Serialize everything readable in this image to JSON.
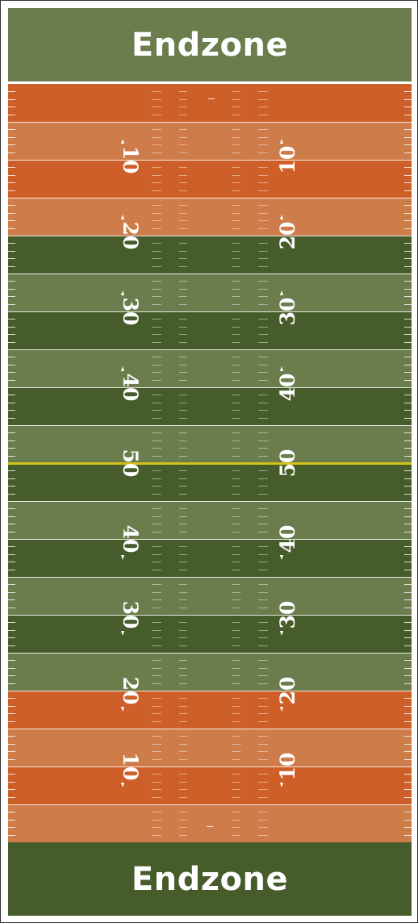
{
  "endzones": {
    "top_label": "Endzone",
    "bottom_label": "Endzone",
    "top_color": "#6b7d4c",
    "bottom_color": "#465c2b"
  },
  "colors": {
    "orange_dark": "#cf5f29",
    "orange_light": "#cd7c4a",
    "green_dark": "#465c2b",
    "green_light": "#6b7d4c",
    "yard_line": "#ffffff",
    "midfield_line": "#d4c21a",
    "hash_mark": "#ffffff",
    "number_color": "#ffffff"
  },
  "field": {
    "band_colors": [
      "orange_dark",
      "orange_light",
      "orange_dark",
      "orange_light",
      "green_dark",
      "green_light",
      "green_dark",
      "green_light",
      "green_dark",
      "green_light",
      "green_dark",
      "green_light",
      "green_dark",
      "green_light",
      "green_dark",
      "green_light",
      "orange_dark",
      "orange_light",
      "orange_dark",
      "orange_light"
    ],
    "yard_numbers": [
      "10",
      "20",
      "30",
      "40",
      "50",
      "40",
      "30",
      "20",
      "10"
    ]
  }
}
